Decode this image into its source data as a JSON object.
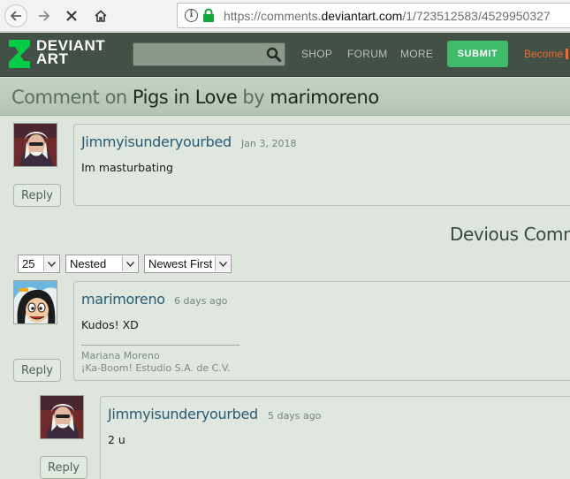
{
  "browser": {
    "url_prefix": "https://comments.",
    "url_domain": "deviantart.com",
    "url_suffix": "/1/723512583/4529950327"
  },
  "header": {
    "logo_line1": "DEVIANT",
    "logo_line2": "ART",
    "search_placeholder": "",
    "nav": [
      "SHOP",
      "FORUM",
      "MORE"
    ],
    "submit": "SUBMIT",
    "become": "Become",
    "colors": {
      "header_bg": "#435045",
      "submit_bg": "#3fbb6a",
      "become": "#f06a33",
      "logo_green": "#05cc47"
    }
  },
  "page": {
    "title_prefix": "Comment on ",
    "title_work": "Pigs in Love",
    "title_by": " by ",
    "title_user": "marimoreno"
  },
  "top_comment": {
    "author": "Jimmyisunderyourbed",
    "date": "Jan 3, 2018",
    "text": "Im masturbating",
    "reply": "Reply"
  },
  "devious_heading": "Devious Comm",
  "controls": {
    "per_page": "25",
    "view_mode": "Nested",
    "sort": "Newest First"
  },
  "comments": [
    {
      "author": "marimoreno",
      "date": "6 days ago",
      "text": "Kudos! XD",
      "signature": [
        "Mariana Moreno",
        "¡Ka-Boom! Estudio S.A. de C.V."
      ],
      "reply": "Reply"
    },
    {
      "author": "Jimmyisunderyourbed",
      "date": "5 days ago",
      "text": "2 u",
      "reply": "Reply"
    }
  ]
}
